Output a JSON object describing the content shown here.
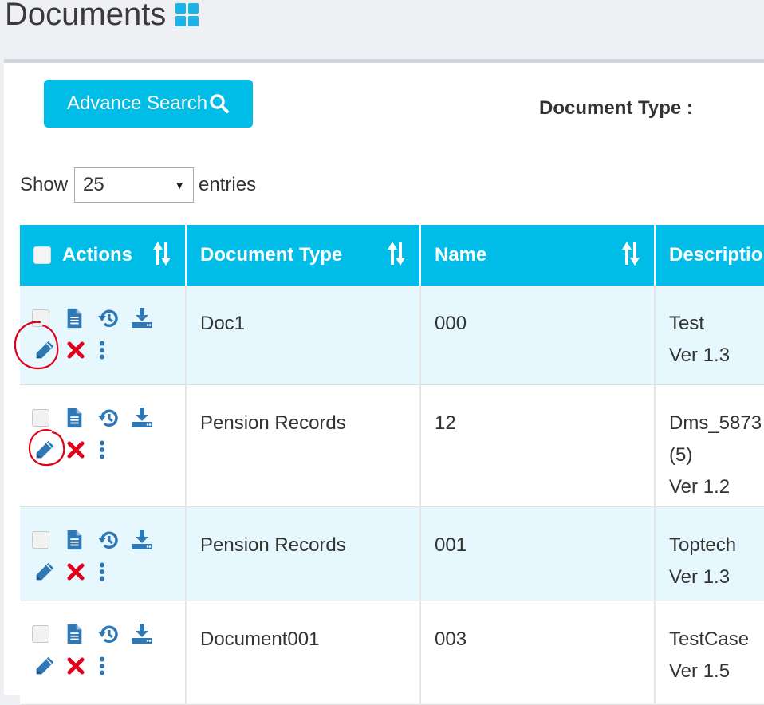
{
  "page": {
    "title": "Documents",
    "accent": "#00bde8"
  },
  "toolbar": {
    "advance_search_label": "Advance Search",
    "document_type_label": "Document Type :"
  },
  "length": {
    "show_label": "Show",
    "value": "25",
    "entries_label": "entries"
  },
  "table": {
    "headers": [
      "Actions",
      "Document Type",
      "Name",
      "Descriptio"
    ],
    "rows": [
      {
        "doc_type": "Doc1",
        "name": "000",
        "desc": [
          "Test",
          "Ver 1.3"
        ]
      },
      {
        "doc_type": "Pension Records",
        "name": "12",
        "desc": [
          "Dms_5873",
          "(5)",
          "Ver 1.2"
        ]
      },
      {
        "doc_type": "Pension Records",
        "name": "001",
        "desc": [
          "Toptech",
          "Ver 1.3"
        ]
      },
      {
        "doc_type": "Document001",
        "name": "003",
        "desc": [
          "TestCase",
          "Ver 1.5"
        ]
      }
    ]
  },
  "icons": {
    "row_actions": [
      "document-icon",
      "history-icon",
      "download-icon",
      "edit-pencil-icon",
      "delete-x-icon",
      "more-vertical-icon"
    ],
    "annotation_color": "#e0001b"
  }
}
